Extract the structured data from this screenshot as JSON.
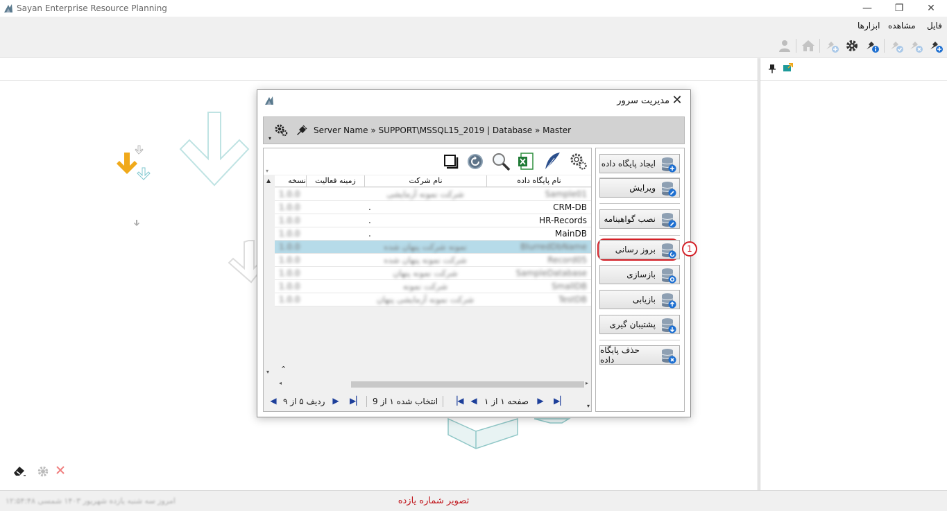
{
  "window": {
    "title": "Sayan Enterprise Resource Planning",
    "minimize": "—",
    "restore": "❐",
    "close": "✕"
  },
  "menu": {
    "file": "فایل",
    "view": "مشاهده",
    "tools": "ابزارها"
  },
  "dialog": {
    "title": "مدیریت سرور",
    "close": "✕",
    "connection": "Server Name » SUPPORT\\MSSQL15_2019 | Database » Master",
    "buttons": {
      "create": "ایجاد پایگاه داده",
      "edit": "ویرایش",
      "install_cert": "نصب گواهینامه",
      "update": "بروز رسانی",
      "restore": "بازسازی",
      "recover": "بازیابی",
      "backup": "پشتیبان گیری",
      "delete": "حذف پایگاه داده"
    },
    "badge": "1",
    "grid": {
      "columns": {
        "db_name": "نام پایگاه داده",
        "company": "نام شرکت",
        "activity": "زمینه فعالیت",
        "version": "نسخه"
      },
      "rows": [
        {
          "db_name": "Sample01",
          "company": "شرکت نمونه آزمایشی",
          "activity": "",
          "version": "1.0.0"
        },
        {
          "db_name": "CRM-DB",
          "company": ".",
          "activity": "",
          "version": "1.0.0"
        },
        {
          "db_name": "HR-Records",
          "company": ".",
          "activity": "",
          "version": "1.0.0"
        },
        {
          "db_name": "MainDB",
          "company": ".",
          "activity": "",
          "version": "1.0.0"
        },
        {
          "db_name": "BlurredDbName",
          "company": "نمونه شرکت پنهان شده",
          "activity": "",
          "version": "1.0.0"
        },
        {
          "db_name": "Record05",
          "company": "شرکت نمونه پنهان شده",
          "activity": "",
          "version": "1.0.0"
        },
        {
          "db_name": "SampleDatabase",
          "company": "شرکت نمونه پنهان",
          "activity": "",
          "version": "1.0.0"
        },
        {
          "db_name": "SmallDB",
          "company": "شرکت نمونه",
          "activity": "",
          "version": "1.0.0"
        },
        {
          "db_name": "TestDB",
          "company": "شرکت نمونه آزمایشی پنهان",
          "activity": "",
          "version": "1.0.0"
        }
      ]
    },
    "pager": {
      "row_text": "ردیف ۵ از ۹",
      "selected_text": "انتخاب شده ۱ از 9",
      "page_text": "صفحه ۱ از ۱"
    }
  },
  "status": {
    "caption": "تصویر شماره یازده",
    "left_text": "امروز سه شنبه یازده شهریور ۱۴۰۳ شمسی ۱۲:۵۴:۴۸"
  },
  "colors": {
    "highlight": "#d42027",
    "selected_row": "#b6dbe9",
    "accent_blue": "#1d6fd1"
  }
}
